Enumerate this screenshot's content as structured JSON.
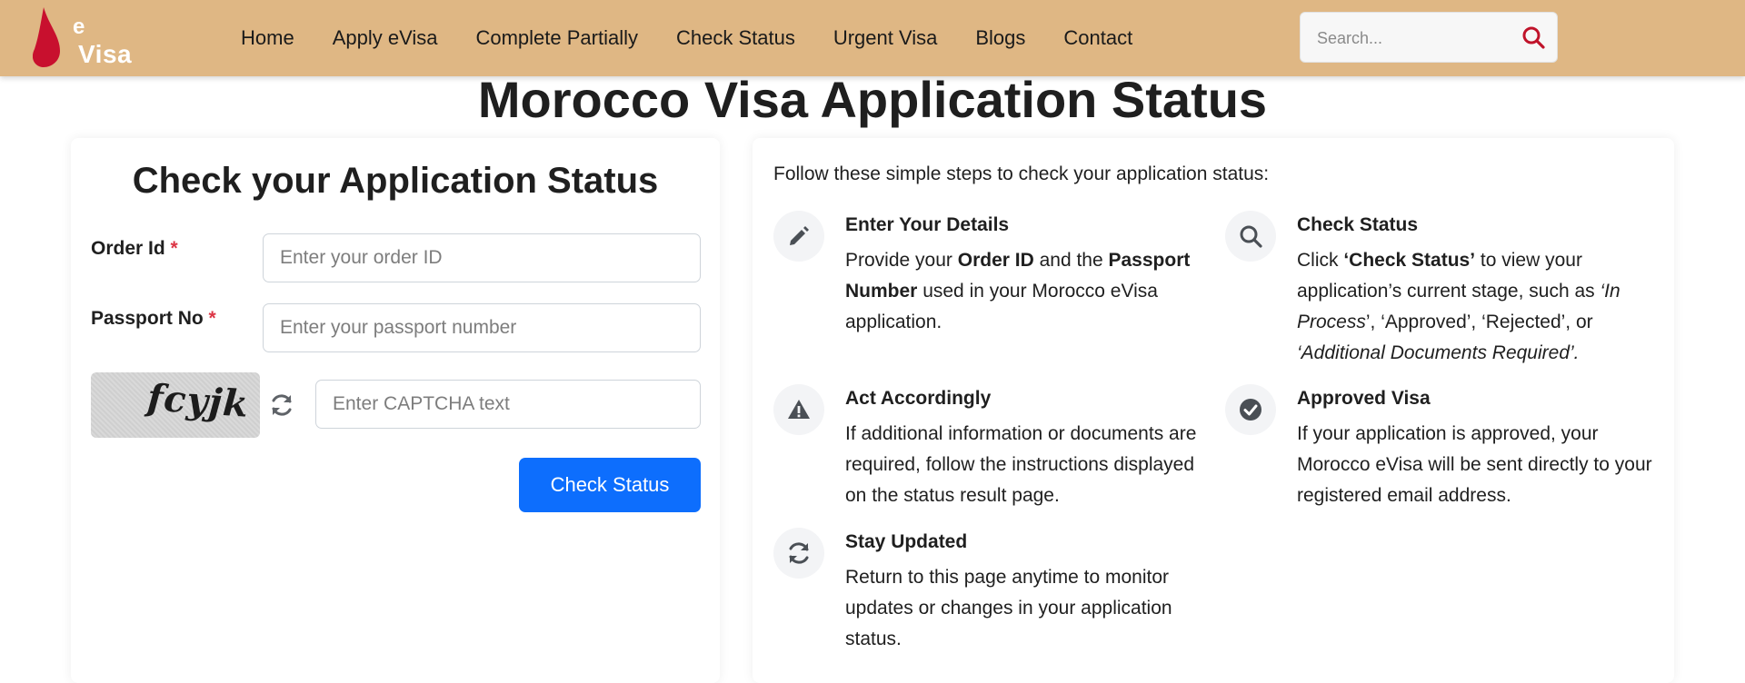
{
  "header": {
    "logo": {
      "e": "e",
      "visa": "Visa"
    },
    "nav": [
      "Home",
      "Apply eVisa",
      "Complete Partially",
      "Check Status",
      "Urgent Visa",
      "Blogs",
      "Contact"
    ],
    "search_placeholder": "Search...",
    "search_icon": "search-icon"
  },
  "page_title": "Morocco Visa Application Status",
  "form": {
    "title": "Check your Application Status",
    "order_label": "Order Id",
    "order_placeholder": "Enter your order ID",
    "passport_label": "Passport No",
    "passport_placeholder": "Enter your passport number",
    "required_marker": "*",
    "captcha_text": "fcyjk",
    "captcha_placeholder": "Enter CAPTCHA text",
    "submit_label": "Check Status"
  },
  "steps": {
    "intro": "Follow these simple steps to check your application status:",
    "enter_details": {
      "title": "Enter Your Details",
      "t1": "Provide your ",
      "b1": "Order ID",
      "t2": " and the ",
      "b2": "Passport Number",
      "t3": " used in your Morocco eVisa application."
    },
    "check_status": {
      "title": "Check Status",
      "t1": "Click ",
      "b1": "‘Check Status’",
      "t2": " to view your application’s current stage, such as ",
      "i1": "‘In Process",
      "t3": "’, ‘Approved’, ‘Rejected’, or ",
      "i2": "‘Additional Documents Required’."
    },
    "act_accordingly": {
      "title": "Act Accordingly",
      "desc": "If additional information or documents are required, follow the instructions displayed on the status result page."
    },
    "approved_visa": {
      "title": "Approved Visa",
      "desc": "If your application is approved, your Morocco eVisa will be sent directly to your registered email address."
    },
    "stay_updated": {
      "title": "Stay Updated",
      "desc": "Return to this page anytime to monitor updates or changes in your application status."
    }
  },
  "colors": {
    "header_bg": "#dfb784",
    "primary": "#0d6efd",
    "required": "#dc3545",
    "search_icon": "#c0132a",
    "logo_red": "#c8102e"
  }
}
